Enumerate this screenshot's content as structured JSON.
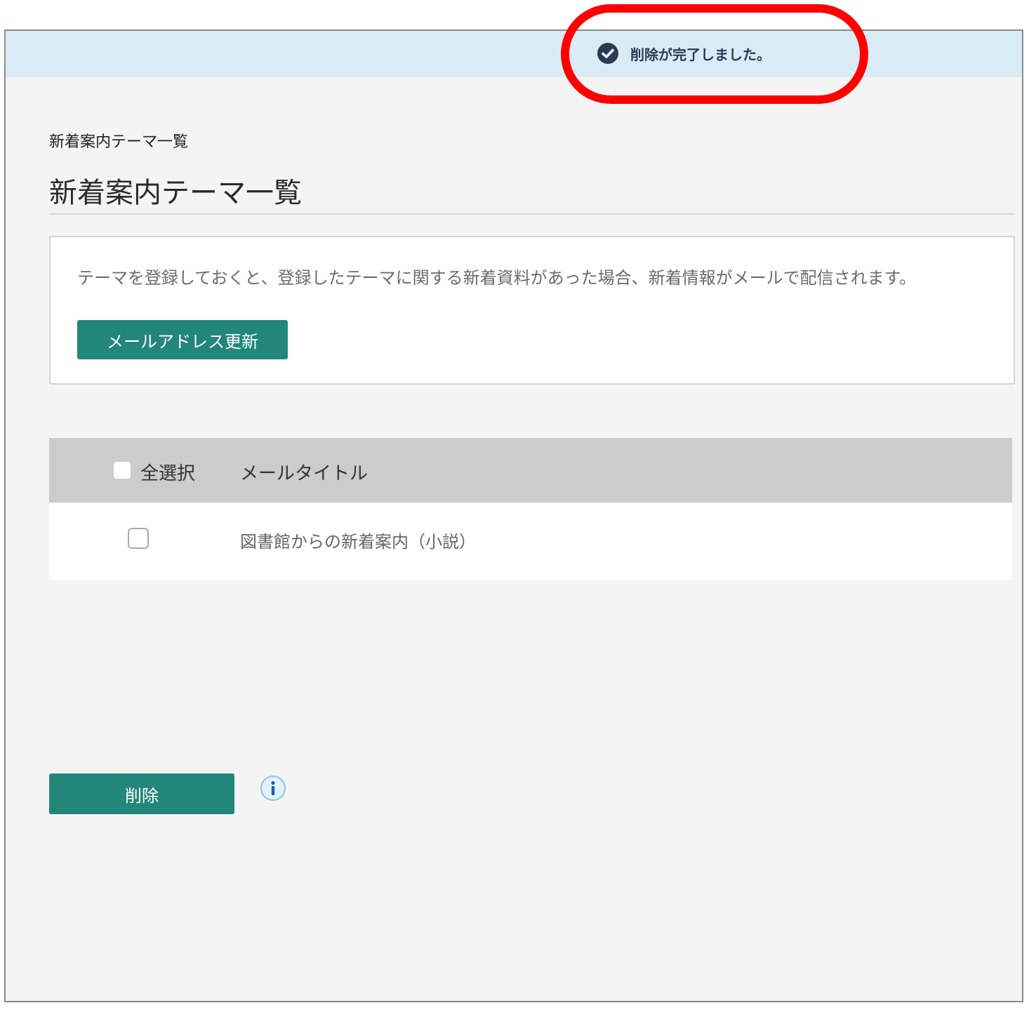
{
  "notification": {
    "message": "削除が完了しました。",
    "icon": "check-circle-icon"
  },
  "breadcrumb": "新着案内テーマ一覧",
  "page_title": "新着案内テーマ一覧",
  "info": {
    "description": "テーマを登録しておくと、登録したテーマに関する新着資料があった場合、新着情報がメールで配信されます。",
    "mail_update_label": "メールアドレス更新"
  },
  "table": {
    "select_all_label": "全選択",
    "title_header": "メールタイトル",
    "rows": [
      {
        "title": "図書館からの新着案内（小説）",
        "checked": false
      }
    ]
  },
  "actions": {
    "delete_label": "削除",
    "info_icon": "info-icon"
  },
  "colors": {
    "accent": "#23867a",
    "notice_bg": "#d9ecf6",
    "notice_text": "#2a3b55",
    "highlight": "#ff0000",
    "header_bg": "#cccccc",
    "page_bg": "#f4f4f4"
  }
}
